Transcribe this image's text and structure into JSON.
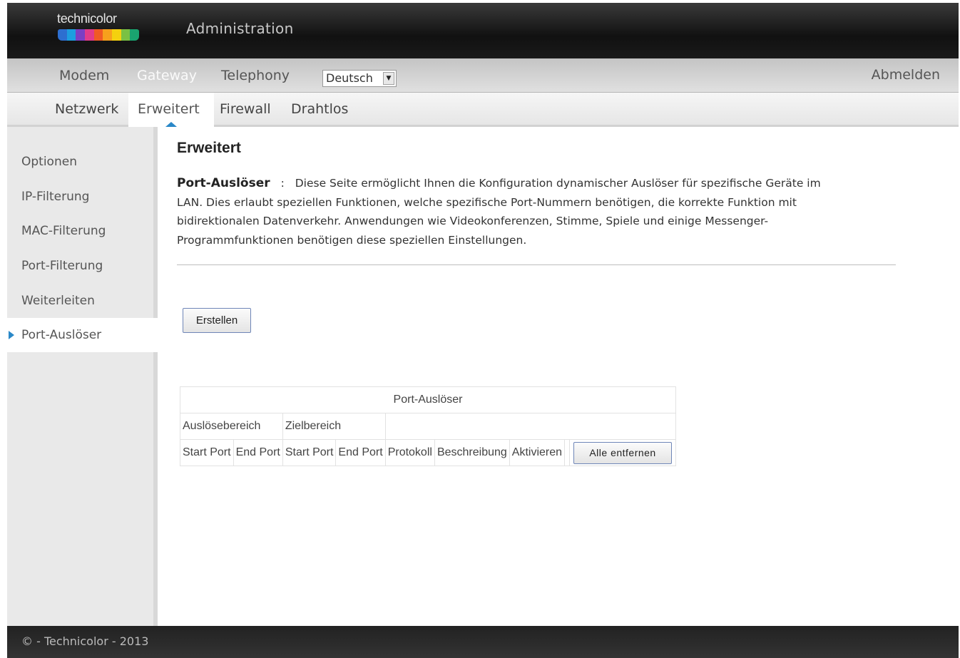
{
  "header": {
    "brand": "technicolor",
    "title": "Administration",
    "logo_colors": [
      "#2d6fd0",
      "#1d9ee0",
      "#7b3fc4",
      "#e23b8a",
      "#f05a24",
      "#f7a01c",
      "#f4d10e",
      "#7ac143",
      "#1aa36f"
    ]
  },
  "main_nav": {
    "items": [
      "Modem",
      "Gateway",
      "Telephony"
    ],
    "active": "Gateway",
    "language": "Deutsch",
    "logout": "Abmelden"
  },
  "sub_nav": {
    "items": [
      "Netzwerk",
      "Erweitert",
      "Firewall",
      "Drahtlos"
    ],
    "active": "Erweitert"
  },
  "sidebar": {
    "items": [
      "Optionen",
      "IP-Filterung",
      "MAC-Filterung",
      "Port-Filterung",
      "Weiterleiten",
      "Port-Auslöser"
    ],
    "active": "Port-Auslöser"
  },
  "content": {
    "title": "Erweitert",
    "desc_label": "Port-Auslöser",
    "desc_sep": ":",
    "desc_lines": [
      "Diese Seite ermöglicht Ihnen die Konfiguration dynamischer Auslöser für spezifische Geräte im",
      "LAN. Dies erlaubt speziellen Funktionen, welche spezifische Port-Nummern benötigen, die korrekte Funktion mit",
      "bidirektionalen Datenverkehr. Anwendungen wie Videokonferenzen, Stimme, Spiele und einige Messenger-",
      "Programmfunktionen benötigen diese speziellen Einstellungen."
    ],
    "create_button": "Erstellen"
  },
  "table": {
    "caption": "Port-Auslöser",
    "group_headers": [
      "Auslösebereich",
      "Zielbereich"
    ],
    "columns": [
      "Start Port",
      "End Port",
      "Start Port",
      "End Port",
      "Protokoll",
      "Beschreibung",
      "Aktivieren"
    ],
    "remove_all_button": "Alle entfernen"
  },
  "footer": {
    "text": "© - Technicolor - 2013"
  }
}
